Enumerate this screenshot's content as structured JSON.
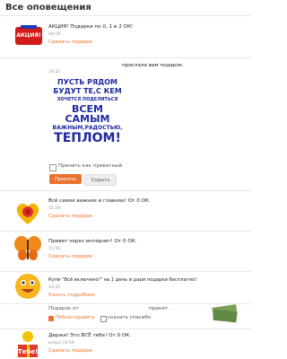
{
  "header": {
    "title": "Все оповещения"
  },
  "notif_promo": {
    "avatar_text": "АКЦИЯ!",
    "text": "АКЦИЯ! Подарки по 0, 1 и 2 ОК!",
    "time": "09:59",
    "link": "Сделать подарок"
  },
  "notif_gift": {
    "time": "16:32",
    "message": "прислала вам подарок.",
    "card_lines": [
      "ПУСТЬ РЯДОМ",
      "БУДУТ ТЕ,С КЕМ",
      "ХОЧЕТСЯ ПОДЕЛИТЬСЯ",
      "ВСЕМ САМЫМ",
      "ВАЖНЫМ,РАДОСТЬЮ,",
      "ТЕПЛОМ!"
    ],
    "private_label": "Принять как приватный",
    "accept_label": "Принять",
    "hide_label": "Скрыть"
  },
  "notif_1": {
    "text": "Всё самое важное и главное! От 0 ОК.",
    "time": "15:59",
    "link": "Сделать подарок"
  },
  "notif_2": {
    "text": "Привет через интернет! От 0 ОК.",
    "time": "15:59",
    "link": "Сделать подарок"
  },
  "notif_3": {
    "text": "Купи \"Всё включено!\" на 1 день и дари подарки бесплатно!",
    "time": "10:45",
    "link": "Узнать подробнее"
  },
  "notif_4": {
    "from_label": "Подарок от",
    "accepted_label": "принят.",
    "reward_label": "Поблагодарить",
    "thanks_label": "сказать спасибо"
  },
  "notif_5": {
    "avatar_text": "Тебе!",
    "text": "Держи! Это ВСЁ тебе! От 0 ОК.",
    "time": "вчера 18:59",
    "link": "Сделать подарок"
  },
  "colors": {
    "accent": "#eb722e",
    "link": "#eb722e",
    "card_text": "#1e2a9e"
  },
  "icons": {
    "close": "close-icon",
    "lock": "lock-icon",
    "gift": "gift-icon"
  }
}
